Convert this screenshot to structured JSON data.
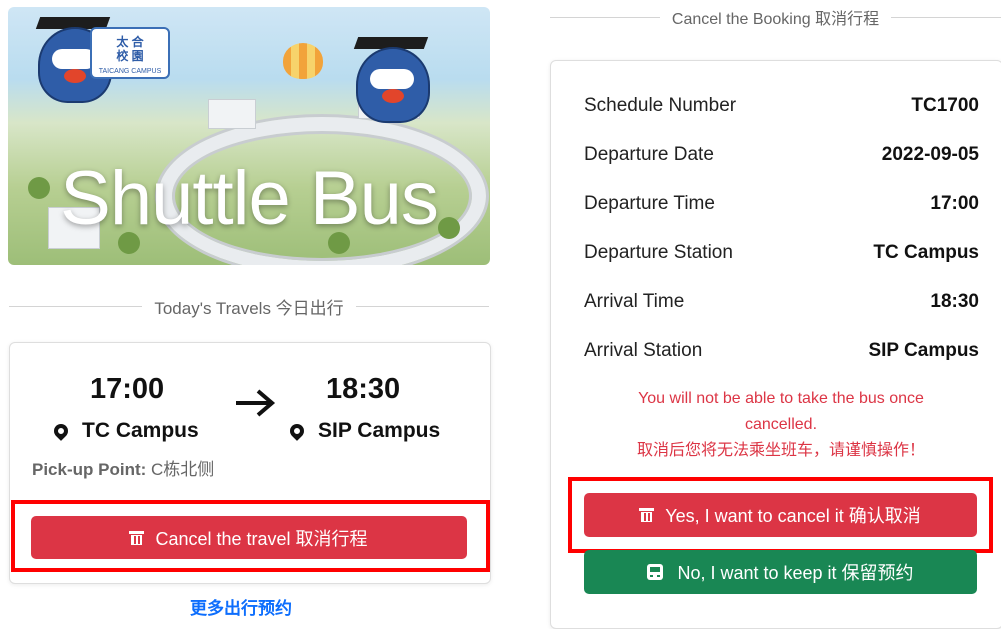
{
  "banner": {
    "title": "Shuttle Bus",
    "sign_line1": "太 合",
    "sign_line2": "校 園",
    "sign_sub": "TAICANG CAMPUS"
  },
  "today": {
    "divider_label": "Today's Travels 今日出行",
    "departure_time": "17:00",
    "arrival_time": "18:30",
    "departure_station": "TC Campus",
    "arrival_station": "SIP Campus",
    "pickup_label": "Pick-up Point:",
    "pickup_value": "C栋北侧",
    "cancel_button": "Cancel the travel 取消行程",
    "more_link": "更多出行预约"
  },
  "cancel_dialog": {
    "divider_label": "Cancel the Booking 取消行程",
    "rows": [
      {
        "label": "Schedule Number",
        "value": "TC1700"
      },
      {
        "label": "Departure Date",
        "value": "2022-09-05"
      },
      {
        "label": "Departure Time",
        "value": "17:00"
      },
      {
        "label": "Departure Station",
        "value": "TC Campus"
      },
      {
        "label": "Arrival Time",
        "value": "18:30"
      },
      {
        "label": "Arrival Station",
        "value": "SIP Campus"
      }
    ],
    "warning_en_1": "You will not be able to take the bus once",
    "warning_en_2": "cancelled.",
    "warning_zh": "取消后您将无法乘坐班车，请谨慎操作！",
    "confirm_button": "Yes, I want to cancel it 确认取消",
    "keep_button": "No, I want to keep it 保留预约"
  },
  "icons": {
    "pin": "map-pin-icon",
    "arrow": "arrow-right-icon",
    "trash": "trash-icon",
    "bus": "bus-icon"
  },
  "colors": {
    "danger": "#dc3545",
    "success": "#198754",
    "link": "#0d6efd",
    "highlight": "#ff0000"
  }
}
